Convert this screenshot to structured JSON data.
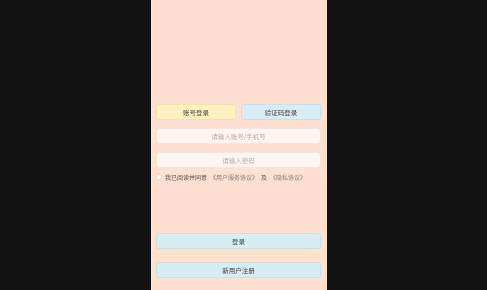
{
  "login": {
    "tabs": {
      "account": "账号登录",
      "code": "验证码登录"
    },
    "fields": {
      "account_placeholder": "请输入账号/手机号",
      "password_placeholder": "请输入密码"
    },
    "agreement": {
      "prefix": "我已阅读并同意",
      "user_service": "《用户服务协议》",
      "and": "及",
      "privacy": "《隐私协议》"
    },
    "buttons": {
      "login": "登录",
      "register": "新用户注册"
    }
  }
}
